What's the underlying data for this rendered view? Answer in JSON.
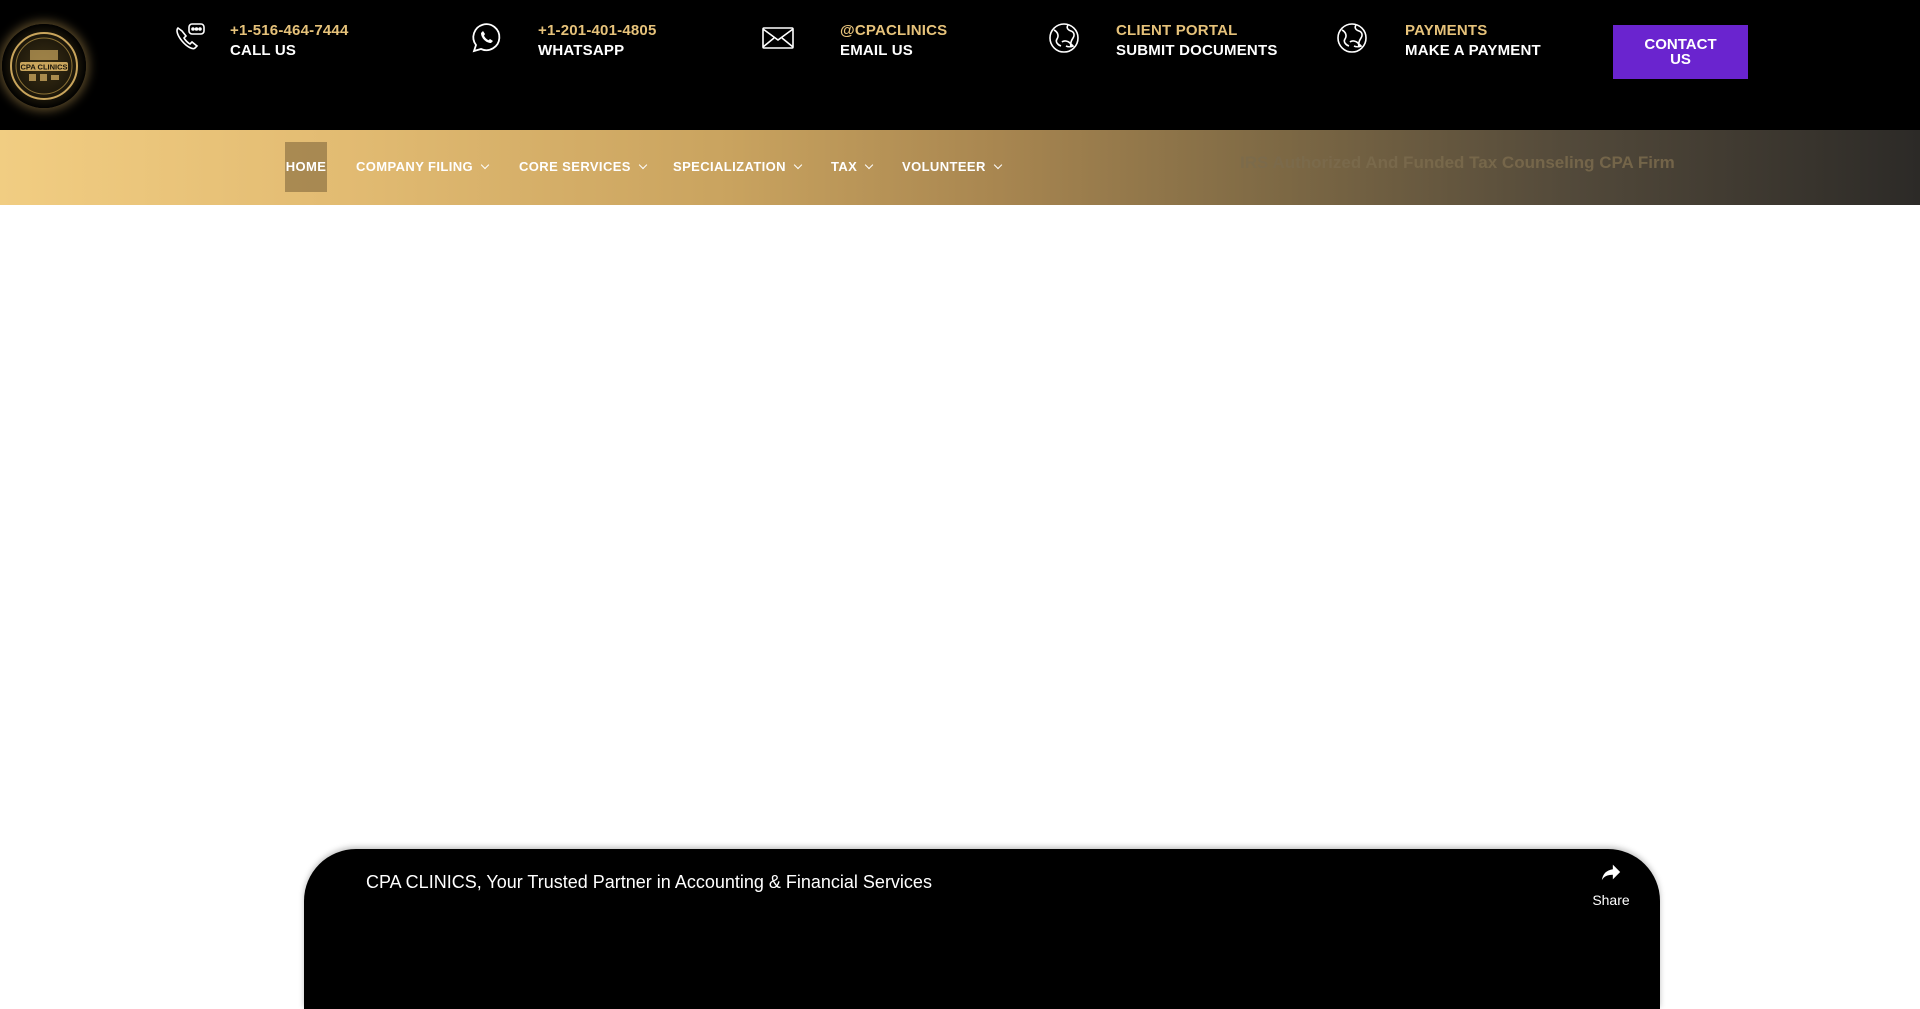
{
  "header": {
    "logo": {
      "icon": "cpa-clinics-logo-icon",
      "text": "CPA CLINICS"
    },
    "contacts": [
      {
        "icon": "phone-chat-icon",
        "line1": "+1-516-464-7444",
        "line2": "CALL US"
      },
      {
        "icon": "whatsapp-icon",
        "line1": "+1-201-401-4805",
        "line2": "WHATSAPP"
      },
      {
        "icon": "envelope-icon",
        "line1": "@CPACLINICS",
        "line2": "EMAIL US"
      },
      {
        "icon": "globe-hand-icon",
        "line1": "CLIENT PORTAL",
        "line2": "SUBMIT DOCUMENTS"
      },
      {
        "icon": "globe-hand-icon",
        "line1": "PAYMENTS",
        "line2": "MAKE A PAYMENT"
      }
    ],
    "contact_button": "CONTACT US"
  },
  "nav": {
    "items": [
      {
        "label": "HOME",
        "active": true,
        "dropdown": false
      },
      {
        "label": "COMPANY FILING",
        "dropdown": true
      },
      {
        "label": "CORE SERVICES",
        "dropdown": true
      },
      {
        "label": "SPECIALIZATION",
        "dropdown": true
      },
      {
        "label": "TAX",
        "dropdown": true
      },
      {
        "label": "VOLUNTEER",
        "dropdown": true
      }
    ],
    "tagline": "IRS Authorized And Funded Tax Counseling CPA Firm"
  },
  "video": {
    "title": "CPA CLINICS, Your Trusted Partner in Accounting & Financial Services",
    "share_label": "Share",
    "share_icon": "share-arrow-icon"
  },
  "colors": {
    "accent_gold": "#e6c27a",
    "contact_button_bg": "#6a24cf",
    "topbar_bg": "#000000"
  }
}
